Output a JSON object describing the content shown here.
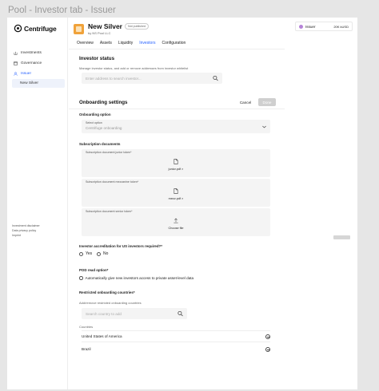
{
  "frame_title": "Pool - Investor tab - Issuer",
  "brand": {
    "name": "Centrifuge"
  },
  "sidebar": {
    "items": [
      {
        "label": "Investments",
        "icon": "chart-icon"
      },
      {
        "label": "Governance",
        "icon": "governance-icon"
      },
      {
        "label": "Issuer",
        "icon": "person-icon",
        "active": true
      }
    ],
    "sub_item": "New Silver",
    "footer": [
      "Investment disclaimer",
      "Data privacy policy",
      "Imprint"
    ]
  },
  "header": {
    "pool_name": "New Silver",
    "badge": "Not published",
    "by": "by NS Pool LLC"
  },
  "account": {
    "label": "Issuer",
    "amount": "20K kUSD"
  },
  "tabs": [
    "Overview",
    "Assets",
    "Liquidity",
    "Investors",
    "Configuration"
  ],
  "active_tab": "Investors",
  "investor_status": {
    "title": "Investor status",
    "description": "Manage investor status, and add or remove addresses from investor whitelist",
    "search_placeholder": "Enter address to search investor..."
  },
  "onboarding": {
    "title": "Onboarding settings",
    "cancel_label": "Cancel",
    "done_label": "Done",
    "option_heading": "Onboarding option",
    "select_label": "Select option",
    "select_value": "Centrifuge onboarding",
    "subscription_heading": "Subscription documents",
    "documents": [
      {
        "label": "Subscription document junior token*",
        "file": "junior.pdf"
      },
      {
        "label": "Subscription document mezzanine token*",
        "file": "mezz.pdf"
      },
      {
        "label": "Subscription document senior token*",
        "file": "Choose file"
      }
    ],
    "accreditation_heading": "Investor accreditation for US investors required?*",
    "accreditation_options": [
      "Yes",
      "No"
    ],
    "pod_heading": "POD read option*",
    "pod_option": "Automatically give new investors access to private asset-level data",
    "restricted_heading": "Restricted onboarding countries*",
    "restricted_description": "Add/remove restricted onboarding countries",
    "country_placeholder": "Search country to add",
    "countries_label": "Countries",
    "countries": [
      "United States of America",
      "Brazil"
    ]
  },
  "colors": {
    "accent": "#2762ff",
    "pool_icon": "#f0a23a",
    "input_bg": "#f4f4f4"
  }
}
